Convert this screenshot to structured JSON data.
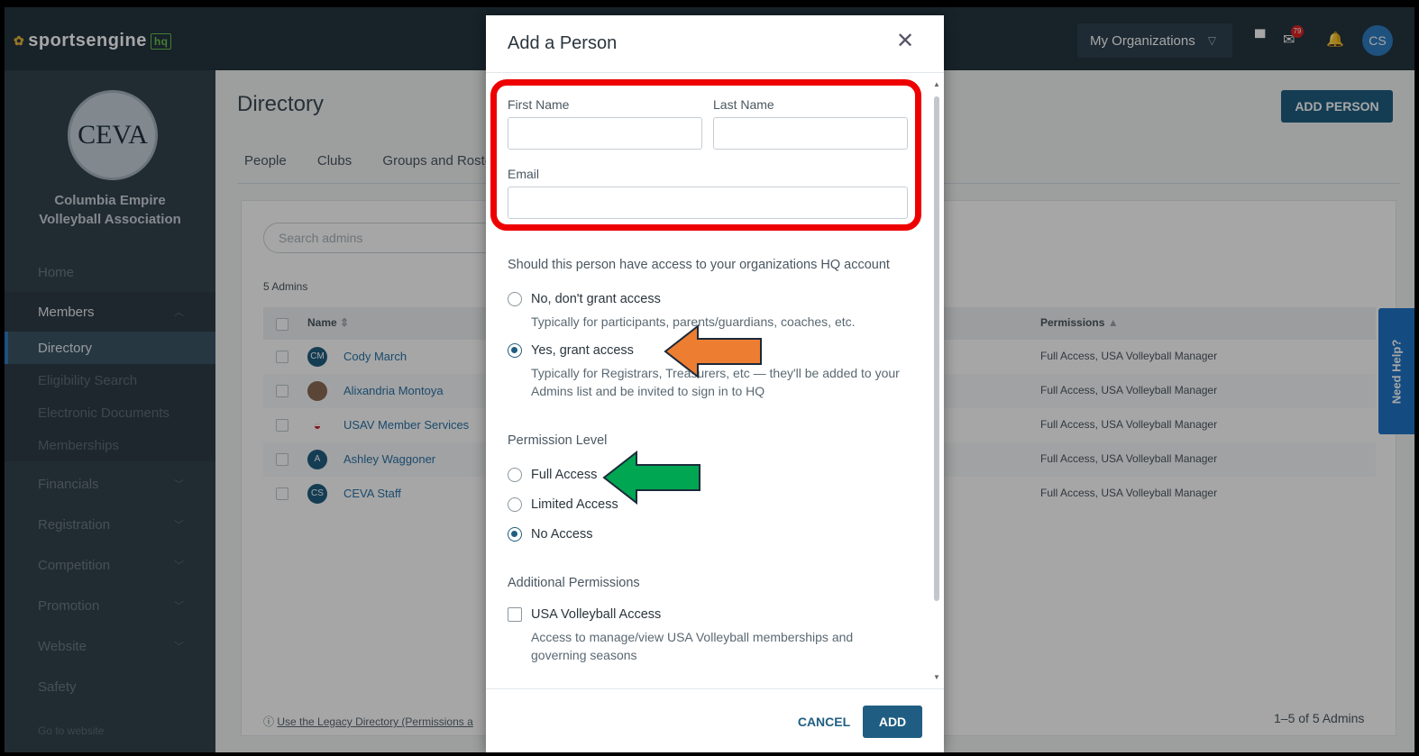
{
  "topbar": {
    "brand": "sportsengine",
    "brand_hq": "hq",
    "my_orgs_label": "My Organizations",
    "notification_count": "79",
    "user_initials": "CS"
  },
  "sidebar": {
    "logo_text": "CEVA",
    "org_name_line1": "Columbia Empire",
    "org_name_line2": "Volleyball Association",
    "items": [
      {
        "label": "Home"
      },
      {
        "label": "Members"
      },
      {
        "label": "Financials"
      },
      {
        "label": "Registration"
      },
      {
        "label": "Competition"
      },
      {
        "label": "Promotion"
      },
      {
        "label": "Website"
      },
      {
        "label": "Safety"
      }
    ],
    "member_sub": [
      {
        "label": "Directory"
      },
      {
        "label": "Eligibility Search"
      },
      {
        "label": "Electronic Documents"
      },
      {
        "label": "Memberships"
      }
    ],
    "go_to_website": "Go to website"
  },
  "main": {
    "title": "Directory",
    "add_person_label": "ADD PERSON",
    "tabs": [
      "People",
      "Clubs",
      "Groups and Rosters"
    ],
    "search_placeholder": "Search admins",
    "admin_count": "5 Admins",
    "columns": {
      "name": "Name",
      "permissions": "Permissions"
    },
    "rows": [
      {
        "initials": "CM",
        "name": "Cody March",
        "permissions": "Full Access, USA Volleyball Manager"
      },
      {
        "initials": "",
        "name": "Alixandria Montoya",
        "permissions": "Full Access, USA Volleyball Manager"
      },
      {
        "initials": "",
        "name": "USAV Member Services",
        "permissions": "Full Access, USA Volleyball Manager"
      },
      {
        "initials": "A",
        "name": "Ashley Waggoner",
        "permissions": "Full Access, USA Volleyball Manager"
      },
      {
        "initials": "CS",
        "name": "CEVA Staff",
        "permissions": "Full Access, USA Volleyball Manager"
      }
    ],
    "legacy_link": "Use the Legacy Directory (Permissions a",
    "pagination": "1–5 of 5 Admins",
    "need_help": "Need Help?"
  },
  "modal": {
    "title": "Add a Person",
    "first_name_label": "First Name",
    "last_name_label": "Last Name",
    "email_label": "Email",
    "first_name_value": "",
    "last_name_value": "",
    "email_value": "",
    "access_question": "Should this person have access to your organizations HQ account",
    "no_access_label": "No, don't grant access",
    "no_access_help": "Typically for participants, parents/guardians, coaches, etc.",
    "yes_access_label": "Yes, grant access",
    "yes_access_help": "Typically for Registrars, Treasurers, etc — they'll be added to your Admins list and be invited to sign in to HQ",
    "permission_level_label": "Permission Level",
    "full_access_label": "Full Access",
    "limited_access_label": "Limited Access",
    "no_access_level_label": "No Access",
    "additional_permissions_label": "Additional Permissions",
    "usav_access_label": "USA Volleyball Access",
    "usav_access_help": "Access to manage/view USA Volleyball memberships and governing seasons",
    "cancel_label": "CANCEL",
    "add_label": "ADD"
  },
  "colors": {
    "primary": "#1f5e82",
    "annotation_red": "#ee0000",
    "annotation_orange": "#ed7d31",
    "annotation_green": "#00a651"
  }
}
